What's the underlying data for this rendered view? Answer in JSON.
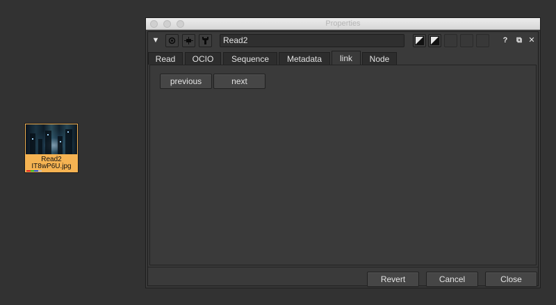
{
  "node": {
    "name": "Read2",
    "file": "IT8wP6U.jpg",
    "channel_colors": [
      "#e02020",
      "#20c020",
      "#2050e0",
      "#c0c0c0"
    ]
  },
  "window": {
    "title": "Properties"
  },
  "toolbar": {
    "collapse_icon": "triangle-down-icon",
    "viewer_icon": "circle-dot-icon",
    "node_color_icon": "node-icon",
    "settings_icon": "wrench-icon",
    "node_name": "Read2",
    "help_label": "?",
    "float_label": "⧉",
    "close_label": "✕"
  },
  "tabs": [
    {
      "label": "Read"
    },
    {
      "label": "OCIO"
    },
    {
      "label": "Sequence"
    },
    {
      "label": "Metadata"
    },
    {
      "label": "link"
    },
    {
      "label": "Node"
    }
  ],
  "active_tab": "link",
  "link_panel": {
    "previous_label": "previous",
    "next_label": "next"
  },
  "footer": {
    "revert_label": "Revert",
    "cancel_label": "Cancel",
    "close_label": "Close"
  }
}
